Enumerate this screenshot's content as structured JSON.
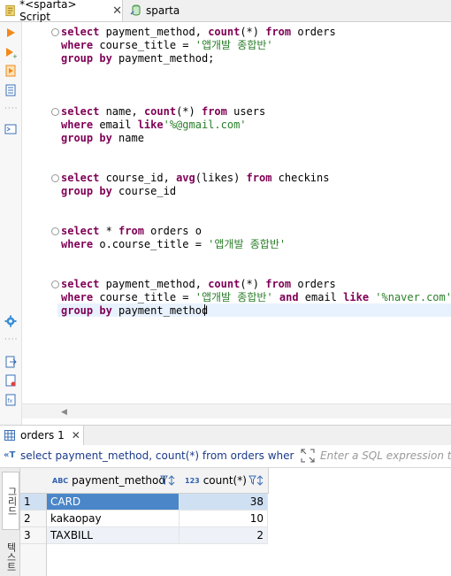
{
  "tabs": [
    {
      "label": "*<sparta> Script",
      "close": "✕"
    },
    {
      "label": "sparta"
    }
  ],
  "editor_lines": [
    [
      {
        "t": "select",
        "c": "kw"
      },
      {
        "t": " payment_method, "
      },
      {
        "t": "count",
        "c": "fn"
      },
      {
        "t": "(*) "
      },
      {
        "t": "from",
        "c": "kw"
      },
      {
        "t": " orders"
      }
    ],
    [
      {
        "t": "where",
        "c": "kw"
      },
      {
        "t": " course_title = "
      },
      {
        "t": "'앱개발 종합반'",
        "c": "str"
      }
    ],
    [
      {
        "t": "group by",
        "c": "kw"
      },
      {
        "t": " payment_method;"
      }
    ],
    [
      {
        "t": "select",
        "c": "kw"
      },
      {
        "t": " name, "
      },
      {
        "t": "count",
        "c": "fn"
      },
      {
        "t": "(*) "
      },
      {
        "t": "from",
        "c": "kw"
      },
      {
        "t": " users"
      }
    ],
    [
      {
        "t": "where",
        "c": "kw"
      },
      {
        "t": " email "
      },
      {
        "t": "like",
        "c": "kw"
      },
      {
        "t": "'%@gmail.com'",
        "c": "str"
      }
    ],
    [
      {
        "t": "group by",
        "c": "kw"
      },
      {
        "t": " name"
      }
    ],
    [
      {
        "t": "select",
        "c": "kw"
      },
      {
        "t": " course_id, "
      },
      {
        "t": "avg",
        "c": "fn"
      },
      {
        "t": "(likes) "
      },
      {
        "t": "from",
        "c": "kw"
      },
      {
        "t": " checkins"
      }
    ],
    [
      {
        "t": "group by",
        "c": "kw"
      },
      {
        "t": " course_id"
      }
    ],
    [
      {
        "t": "select",
        "c": "kw"
      },
      {
        "t": " * "
      },
      {
        "t": "from",
        "c": "kw"
      },
      {
        "t": " orders o"
      }
    ],
    [
      {
        "t": "where",
        "c": "kw"
      },
      {
        "t": " o.course_title = "
      },
      {
        "t": "'앱개발 종합반'",
        "c": "str"
      }
    ],
    [
      {
        "t": "select",
        "c": "kw"
      },
      {
        "t": " payment_method, "
      },
      {
        "t": "count",
        "c": "fn"
      },
      {
        "t": "(*) "
      },
      {
        "t": "from",
        "c": "kw"
      },
      {
        "t": " orders"
      }
    ],
    [
      {
        "t": "where",
        "c": "kw"
      },
      {
        "t": " course_title = "
      },
      {
        "t": "'앱개발 종합반'",
        "c": "str"
      },
      {
        "t": " "
      },
      {
        "t": "and",
        "c": "kw"
      },
      {
        "t": " email "
      },
      {
        "t": "like",
        "c": "kw"
      },
      {
        "t": " "
      },
      {
        "t": "'%naver.com'",
        "c": "str"
      }
    ],
    [
      {
        "t": "group by",
        "c": "kw"
      },
      {
        "t": " payment_method"
      }
    ]
  ],
  "results_tab": {
    "label": "orders 1",
    "close": "✕"
  },
  "query_text": "select payment_method, count(*) from orders where cou",
  "expression_placeholder": "Enter a SQL expression to fi",
  "side_tabs": {
    "grid": "그리드",
    "text": "텍스트"
  },
  "grid": {
    "columns": [
      {
        "type": "ABC",
        "label": "payment_method"
      },
      {
        "type": "123",
        "label": "count(*)"
      }
    ],
    "rows": [
      {
        "num": "1",
        "payment_method": "CARD",
        "count": "38"
      },
      {
        "num": "2",
        "payment_method": "kakaopay",
        "count": "10"
      },
      {
        "num": "3",
        "payment_method": "TAXBILL",
        "count": "2"
      }
    ]
  },
  "colors": {
    "keyword": "#7f0055",
    "string": "#2a7e2a",
    "selection": "#4a86c8"
  }
}
